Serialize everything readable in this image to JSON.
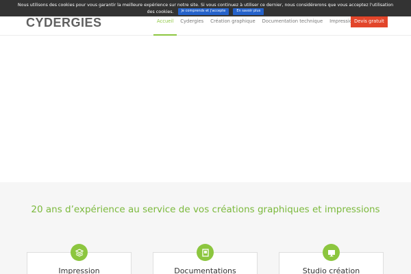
{
  "cookie_banner": {
    "text_line1": "Nous utilisons des cookies pour vous garantir la meilleure expérience sur notre site. Si vous continuez à utiliser ce dernier, nous considérerons que vous acceptez l'utilisation",
    "text_line2": "des cookies.",
    "accept_label": "Je comprends et j'accepte",
    "more_label": "En savoir plus",
    "accent_color": "#1d5cc8"
  },
  "header": {
    "logo": "CYDERGIES",
    "nav": [
      {
        "label": "Accueil",
        "active": true
      },
      {
        "label": "Cydergies"
      },
      {
        "label": "Création graphique"
      },
      {
        "label": "Documentation technique"
      },
      {
        "label": "Impression"
      }
    ],
    "cta_label": "Devis gratuit",
    "cta_color": "#e2452a",
    "accent_color": "#8cc63f"
  },
  "section": {
    "headline": "20 ans d’expérience au service de vos créations graphiques et impressions",
    "cards": [
      {
        "title": "Impression",
        "icon": "layers-icon"
      },
      {
        "title": "Documentations",
        "icon": "document-icon"
      },
      {
        "title": "Studio création",
        "icon": "monitor-icon"
      }
    ]
  }
}
